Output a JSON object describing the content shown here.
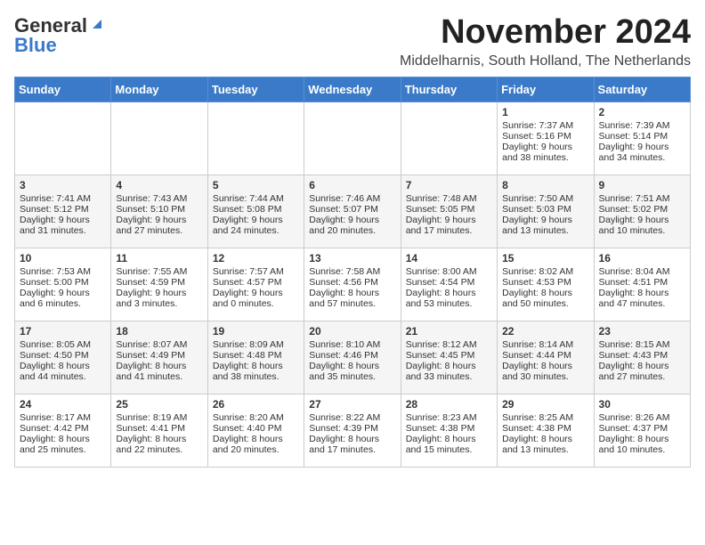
{
  "header": {
    "logo_general": "General",
    "logo_blue": "Blue",
    "month_title": "November 2024",
    "location": "Middelharnis, South Holland, The Netherlands"
  },
  "weekdays": [
    "Sunday",
    "Monday",
    "Tuesday",
    "Wednesday",
    "Thursday",
    "Friday",
    "Saturday"
  ],
  "weeks": [
    [
      {
        "day": "",
        "sunrise": "",
        "sunset": "",
        "daylight": ""
      },
      {
        "day": "",
        "sunrise": "",
        "sunset": "",
        "daylight": ""
      },
      {
        "day": "",
        "sunrise": "",
        "sunset": "",
        "daylight": ""
      },
      {
        "day": "",
        "sunrise": "",
        "sunset": "",
        "daylight": ""
      },
      {
        "day": "",
        "sunrise": "",
        "sunset": "",
        "daylight": ""
      },
      {
        "day": "1",
        "sunrise": "Sunrise: 7:37 AM",
        "sunset": "Sunset: 5:16 PM",
        "daylight": "Daylight: 9 hours and 38 minutes."
      },
      {
        "day": "2",
        "sunrise": "Sunrise: 7:39 AM",
        "sunset": "Sunset: 5:14 PM",
        "daylight": "Daylight: 9 hours and 34 minutes."
      }
    ],
    [
      {
        "day": "3",
        "sunrise": "Sunrise: 7:41 AM",
        "sunset": "Sunset: 5:12 PM",
        "daylight": "Daylight: 9 hours and 31 minutes."
      },
      {
        "day": "4",
        "sunrise": "Sunrise: 7:43 AM",
        "sunset": "Sunset: 5:10 PM",
        "daylight": "Daylight: 9 hours and 27 minutes."
      },
      {
        "day": "5",
        "sunrise": "Sunrise: 7:44 AM",
        "sunset": "Sunset: 5:08 PM",
        "daylight": "Daylight: 9 hours and 24 minutes."
      },
      {
        "day": "6",
        "sunrise": "Sunrise: 7:46 AM",
        "sunset": "Sunset: 5:07 PM",
        "daylight": "Daylight: 9 hours and 20 minutes."
      },
      {
        "day": "7",
        "sunrise": "Sunrise: 7:48 AM",
        "sunset": "Sunset: 5:05 PM",
        "daylight": "Daylight: 9 hours and 17 minutes."
      },
      {
        "day": "8",
        "sunrise": "Sunrise: 7:50 AM",
        "sunset": "Sunset: 5:03 PM",
        "daylight": "Daylight: 9 hours and 13 minutes."
      },
      {
        "day": "9",
        "sunrise": "Sunrise: 7:51 AM",
        "sunset": "Sunset: 5:02 PM",
        "daylight": "Daylight: 9 hours and 10 minutes."
      }
    ],
    [
      {
        "day": "10",
        "sunrise": "Sunrise: 7:53 AM",
        "sunset": "Sunset: 5:00 PM",
        "daylight": "Daylight: 9 hours and 6 minutes."
      },
      {
        "day": "11",
        "sunrise": "Sunrise: 7:55 AM",
        "sunset": "Sunset: 4:59 PM",
        "daylight": "Daylight: 9 hours and 3 minutes."
      },
      {
        "day": "12",
        "sunrise": "Sunrise: 7:57 AM",
        "sunset": "Sunset: 4:57 PM",
        "daylight": "Daylight: 9 hours and 0 minutes."
      },
      {
        "day": "13",
        "sunrise": "Sunrise: 7:58 AM",
        "sunset": "Sunset: 4:56 PM",
        "daylight": "Daylight: 8 hours and 57 minutes."
      },
      {
        "day": "14",
        "sunrise": "Sunrise: 8:00 AM",
        "sunset": "Sunset: 4:54 PM",
        "daylight": "Daylight: 8 hours and 53 minutes."
      },
      {
        "day": "15",
        "sunrise": "Sunrise: 8:02 AM",
        "sunset": "Sunset: 4:53 PM",
        "daylight": "Daylight: 8 hours and 50 minutes."
      },
      {
        "day": "16",
        "sunrise": "Sunrise: 8:04 AM",
        "sunset": "Sunset: 4:51 PM",
        "daylight": "Daylight: 8 hours and 47 minutes."
      }
    ],
    [
      {
        "day": "17",
        "sunrise": "Sunrise: 8:05 AM",
        "sunset": "Sunset: 4:50 PM",
        "daylight": "Daylight: 8 hours and 44 minutes."
      },
      {
        "day": "18",
        "sunrise": "Sunrise: 8:07 AM",
        "sunset": "Sunset: 4:49 PM",
        "daylight": "Daylight: 8 hours and 41 minutes."
      },
      {
        "day": "19",
        "sunrise": "Sunrise: 8:09 AM",
        "sunset": "Sunset: 4:48 PM",
        "daylight": "Daylight: 8 hours and 38 minutes."
      },
      {
        "day": "20",
        "sunrise": "Sunrise: 8:10 AM",
        "sunset": "Sunset: 4:46 PM",
        "daylight": "Daylight: 8 hours and 35 minutes."
      },
      {
        "day": "21",
        "sunrise": "Sunrise: 8:12 AM",
        "sunset": "Sunset: 4:45 PM",
        "daylight": "Daylight: 8 hours and 33 minutes."
      },
      {
        "day": "22",
        "sunrise": "Sunrise: 8:14 AM",
        "sunset": "Sunset: 4:44 PM",
        "daylight": "Daylight: 8 hours and 30 minutes."
      },
      {
        "day": "23",
        "sunrise": "Sunrise: 8:15 AM",
        "sunset": "Sunset: 4:43 PM",
        "daylight": "Daylight: 8 hours and 27 minutes."
      }
    ],
    [
      {
        "day": "24",
        "sunrise": "Sunrise: 8:17 AM",
        "sunset": "Sunset: 4:42 PM",
        "daylight": "Daylight: 8 hours and 25 minutes."
      },
      {
        "day": "25",
        "sunrise": "Sunrise: 8:19 AM",
        "sunset": "Sunset: 4:41 PM",
        "daylight": "Daylight: 8 hours and 22 minutes."
      },
      {
        "day": "26",
        "sunrise": "Sunrise: 8:20 AM",
        "sunset": "Sunset: 4:40 PM",
        "daylight": "Daylight: 8 hours and 20 minutes."
      },
      {
        "day": "27",
        "sunrise": "Sunrise: 8:22 AM",
        "sunset": "Sunset: 4:39 PM",
        "daylight": "Daylight: 8 hours and 17 minutes."
      },
      {
        "day": "28",
        "sunrise": "Sunrise: 8:23 AM",
        "sunset": "Sunset: 4:38 PM",
        "daylight": "Daylight: 8 hours and 15 minutes."
      },
      {
        "day": "29",
        "sunrise": "Sunrise: 8:25 AM",
        "sunset": "Sunset: 4:38 PM",
        "daylight": "Daylight: 8 hours and 13 minutes."
      },
      {
        "day": "30",
        "sunrise": "Sunrise: 8:26 AM",
        "sunset": "Sunset: 4:37 PM",
        "daylight": "Daylight: 8 hours and 10 minutes."
      }
    ]
  ]
}
